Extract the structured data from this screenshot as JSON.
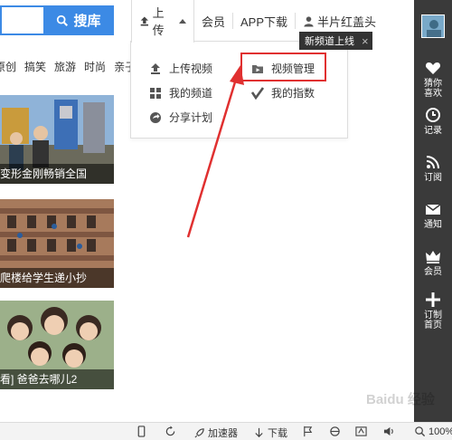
{
  "search": {
    "button_label": "搜库",
    "value": ""
  },
  "categories": [
    "原创",
    "搞笑",
    "旅游",
    "时尚",
    "亲子"
  ],
  "top_nav": {
    "upload": "上传",
    "member": "会员",
    "app": "APP下载",
    "user": "半片红盖头"
  },
  "dropdown": {
    "upload_video": "上传视频",
    "video_manage": "视频管理",
    "my_channel": "我的频道",
    "my_index": "我的指数",
    "share_plan": "分享计划"
  },
  "tooltip": {
    "text": "新频道上线",
    "close": "×"
  },
  "thumbnails": [
    {
      "caption": "变形金刚畅销全国"
    },
    {
      "caption": "爬楼给学生递小抄"
    },
    {
      "caption": "看] 爸爸去哪儿2"
    }
  ],
  "sidebar": {
    "items": [
      {
        "label_line1": "猜你",
        "label_line2": "喜欢"
      },
      {
        "label_line1": "记录",
        "label_line2": ""
      },
      {
        "label_line1": "订阅",
        "label_line2": ""
      },
      {
        "label_line1": "通知",
        "label_line2": ""
      },
      {
        "label_line1": "会员",
        "label_line2": ""
      },
      {
        "label_line1": "订制",
        "label_line2": "首页"
      }
    ]
  },
  "statusbar": {
    "accelerator": "加速器",
    "download": "下载",
    "zoom": "100%"
  },
  "watermark": "Baidu 经验",
  "colors": {
    "accent": "#3c8ae5",
    "highlight": "#e03030",
    "sidebar": "#3a3a3a"
  }
}
